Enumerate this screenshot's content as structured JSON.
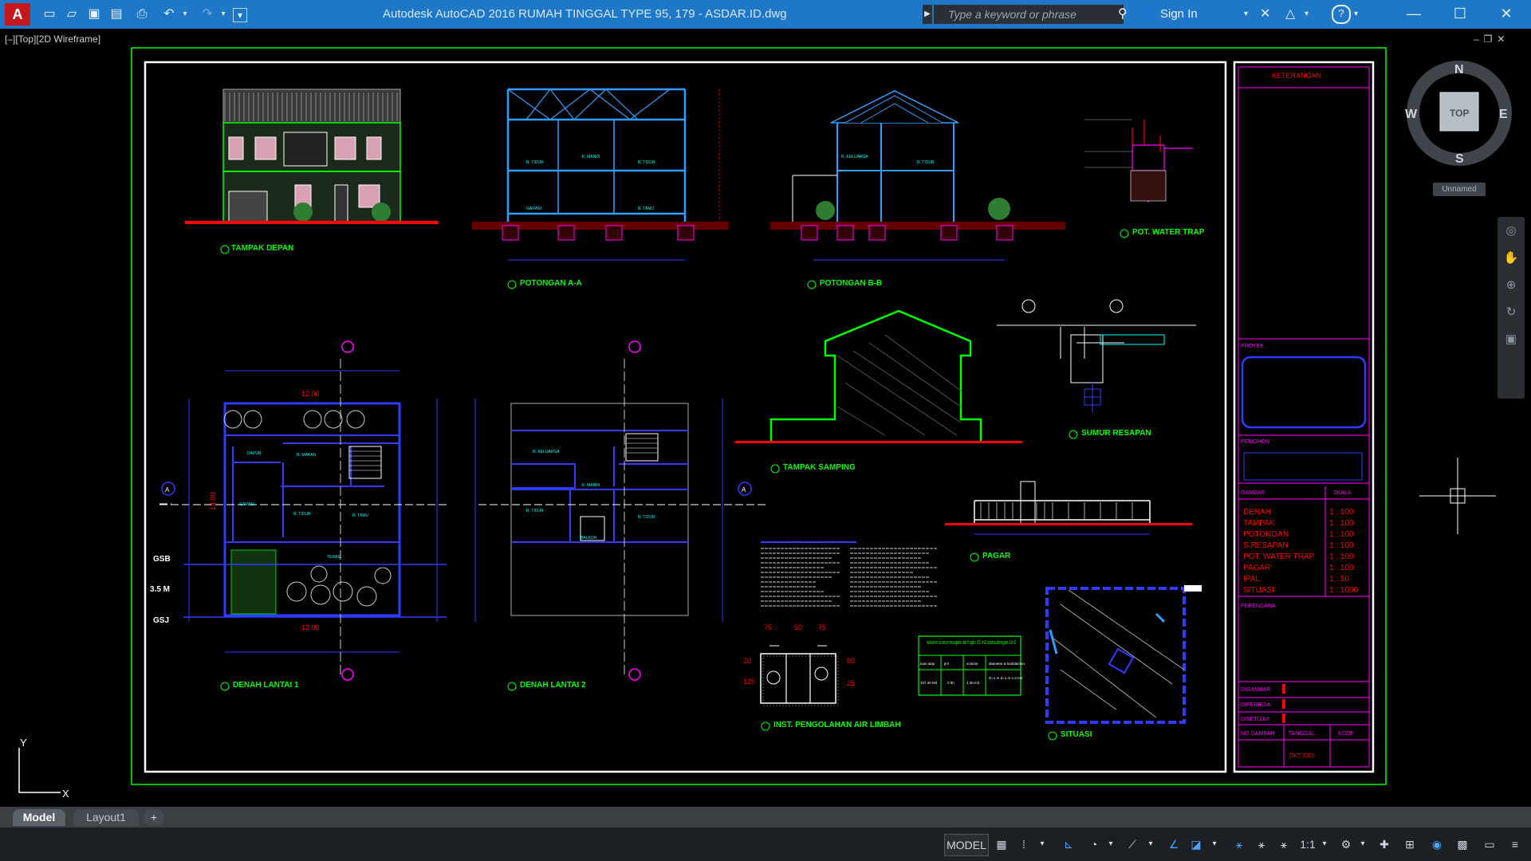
{
  "app": {
    "title": "Autodesk AutoCAD 2016      RUMAH TINGGAL TYPE 95, 179 - ASDAR.ID.dwg",
    "search_placeholder": "Type a keyword or phrase",
    "sign_in": "Sign In",
    "viewport_label": "[–][Top][2D Wireframe]"
  },
  "colors": {
    "background": "#000000",
    "titlebar": "#1f77c8",
    "frame_green": "#00ff00",
    "blue": "#2f3cff",
    "magenta": "#ff00ff",
    "red": "#ff0000",
    "cyan": "#00ffff",
    "yellow": "#ffff00"
  },
  "viewcube": {
    "north": "N",
    "south": "S",
    "east": "E",
    "west": "W",
    "face": "TOP",
    "ucs": "Unnamed"
  },
  "ucs_icon": {
    "y": "Y",
    "x": "X"
  },
  "tabs": [
    {
      "label": "Model"
    },
    {
      "label": "Layout1"
    },
    {
      "label": "+"
    }
  ],
  "statusbar": {
    "model": "MODEL",
    "scale": "1:1"
  },
  "drawing": {
    "views": {
      "tampak_depan": "TAMPAK DEPAN",
      "potongan_aa": "POTONGAN A-A",
      "potongan_bb": "POTONGAN B-B",
      "pot_water_trap": "POT. WATER TRAP",
      "sumur_resapan": "SUMUR RESAPAN",
      "tampak_samping": "TAMPAK SAMPING",
      "pagar": "PAGAR",
      "denah_lantai1": "DENAH LANTAI 1",
      "denah_lantai2": "DENAH LANTAI 2",
      "ipal": "INST. PENGOLAHAN AIR LIMBAH",
      "situasi": "SITUASI"
    },
    "dims": {
      "width_12": "12.00",
      "depth_14": "14.00",
      "gsb": "GSB",
      "gsj": "GSJ",
      "setback": "3.5 M"
    },
    "rooms": {
      "dapur": "DAPUR",
      "r_makan": "R. MAKAN",
      "garasi": "GARASI",
      "r_tamu": "R. TAMU",
      "r_tidur": "R. TIDUR",
      "teras": "TERAS",
      "kamar_mandi": "K. MANDI",
      "r_keluarga": "R. KELUARGA",
      "r_tidur_utama": "R. TIDUR",
      "balkon": "BALKON"
    },
    "sumur_table": {
      "title": "volume sumur resapan air hujan 25 m2 sama dengan 1m3",
      "headers": [
        "luas atap",
        "jml",
        "volume",
        "diameter & kedalaman"
      ],
      "row": [
        "107.40 M2",
        "2 bh",
        "4.30 m3",
        "D=1 m d=1 m t=3 m3"
      ]
    },
    "ipal_dims": [
      "75",
      "50",
      "75",
      "125",
      "20",
      "80",
      "25"
    ],
    "title_block": {
      "keterangan": "KETERANGAN",
      "proyek": "PROYEK",
      "pemohon": "PEMOHON",
      "gambar": "GAMBAR",
      "skala": "SKALA",
      "items": [
        {
          "name": "DENAH",
          "scale": "1 : 100"
        },
        {
          "name": "TAMPAK",
          "scale": "1 : 100"
        },
        {
          "name": "POTONGAN",
          "scale": "1 : 100"
        },
        {
          "name": "S.RESAPAN",
          "scale": "1 : 100"
        },
        {
          "name": "POT. WATER TRAP",
          "scale": "1 : 100"
        },
        {
          "name": "PAGAR",
          "scale": "1 : 100"
        },
        {
          "name": "IPAL",
          "scale": "1 : 50"
        },
        {
          "name": "SITUASI",
          "scale": "1 : 1000"
        }
      ],
      "perencana": "PERENCANA",
      "digambar": "DIGAMBAR",
      "diperiksa": "DIPERIKSA",
      "disetujui": "DISETUJUI",
      "no_gambar": "NO.GAMBAR",
      "tanggal": "TANGGAL",
      "kode": "KODE",
      "date": "OKT 2016"
    }
  }
}
